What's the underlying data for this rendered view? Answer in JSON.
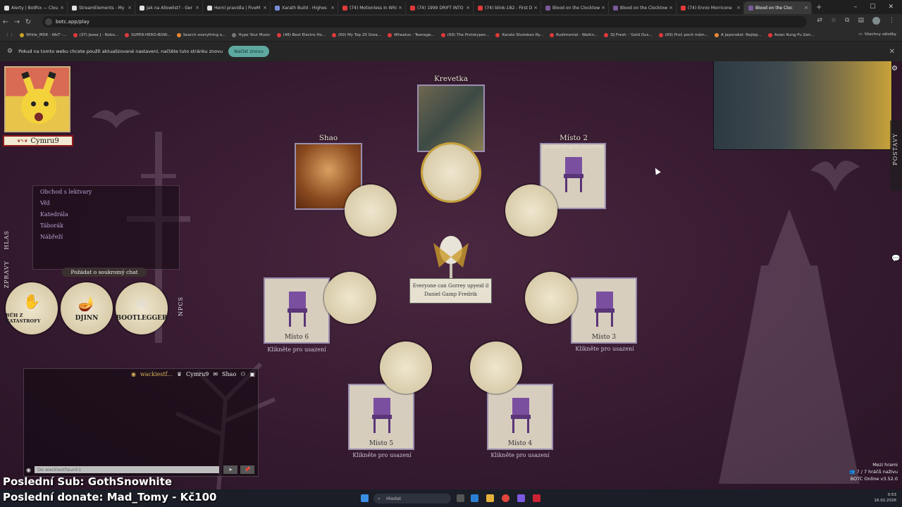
{
  "browser": {
    "tabs": [
      {
        "label": "Alerty | BotRix — Clou",
        "color": "#e1e1e1"
      },
      {
        "label": "StreamElements - My",
        "color": "#e1e1e1"
      },
      {
        "label": "Jak na Allowlist? - Ger",
        "color": "#e1e1e1"
      },
      {
        "label": "Herní pravidla | FiveM",
        "color": "#e1e1e1"
      },
      {
        "label": "Xarath Build - Highes",
        "color": "#7a8cd8"
      },
      {
        "label": "(74) Motionless In Whi",
        "color": "#e03a3a"
      },
      {
        "label": "(74) 1999 DRIFT INTO",
        "color": "#e03a3a"
      },
      {
        "label": "(74) blink-182 - First D",
        "color": "#e03a3a"
      },
      {
        "label": "Blood on the Clocktow",
        "color": "#7a5a9a"
      },
      {
        "label": "Blood on the Clocktow",
        "color": "#7a5a9a"
      },
      {
        "label": "(74) Ennio Morricone",
        "color": "#e03a3a"
      },
      {
        "label": "Blood on the Cloc",
        "color": "#7a5a9a"
      }
    ],
    "active_tab_index": 11,
    "url": "botc.app/play",
    "bookmarks": [
      "White_MDK - WoT -...",
      "(37) Jesse J - Nobo...",
      "SUPER-HERO-BOW...",
      "Search everything o...",
      "Hype Your Music",
      "(48) Best Electro Ho...",
      "(69) My Top 20 Grea...",
      "Wheatus - Teenage...",
      "(69) The Prototypes...",
      "Karate Shotokan Ry...",
      "Rudimental - Waitin...",
      "DJ Fresh - 'Gold Dus...",
      "(69) Proč pocit mám...",
      "A Japonskol: Nejlep...",
      "Asian Kung-Fu Gen..."
    ],
    "bookmarks_right": "Všechny záložky",
    "infobar_text": "Pokud na tomto webu chcete použít aktualizované nastavení, načtěte tuto stránku znovu",
    "infobar_button": "Načíst znovu"
  },
  "game": {
    "player_name": "Cymru9",
    "locations": [
      "Obchod s lektvary",
      "Věž",
      "Katedrála",
      "Táborák",
      "Nábřeží"
    ],
    "private_chat_button": "Požádat o soukromý chat",
    "side_tabs": {
      "hlas": "HLAS",
      "zpravy": "ZPRÁVY",
      "npcs": "NPCS"
    },
    "role_tokens": [
      "BŮH Z KATASTROFY",
      "DJINN",
      "BOOTLEGGER"
    ],
    "chat": {
      "user_a": "wackiestf...",
      "user_b": "Cymru9",
      "user_c": "Shao",
      "input_placeholder": "Do wackiestfaun51"
    },
    "seats": {
      "krevetka": "Krevetka",
      "shao": "Shao",
      "misto2": "Místo 2",
      "misto3": "Místo 3",
      "misto4": "Místo 4",
      "misto5": "Místo 5",
      "misto6": "Místo 6",
      "click_to_sit": "Klikněte pro usazení"
    },
    "center_sign": {
      "line1": "Everyone can Gorrey upyeid il",
      "line2": "Daniel Gamp Fredrik"
    },
    "right_tab": "POSTAVY",
    "status": {
      "title": "Mezi hrami",
      "players": "7 / 7 hráčů naživu",
      "version": "BOTC Online v3.52.0"
    }
  },
  "overlay": {
    "last_sub": "Poslední Sub: GothSnowhite",
    "last_donate": "Poslední donate: Mad_Tomy - Kč100"
  },
  "taskbar": {
    "search": "Hledat",
    "time": "0:53",
    "date": "16.02.2026"
  },
  "colors": {
    "accent": "#5ea8a0",
    "chat_highlight": "#d9b45a",
    "location_text": "#b7a3d6"
  }
}
